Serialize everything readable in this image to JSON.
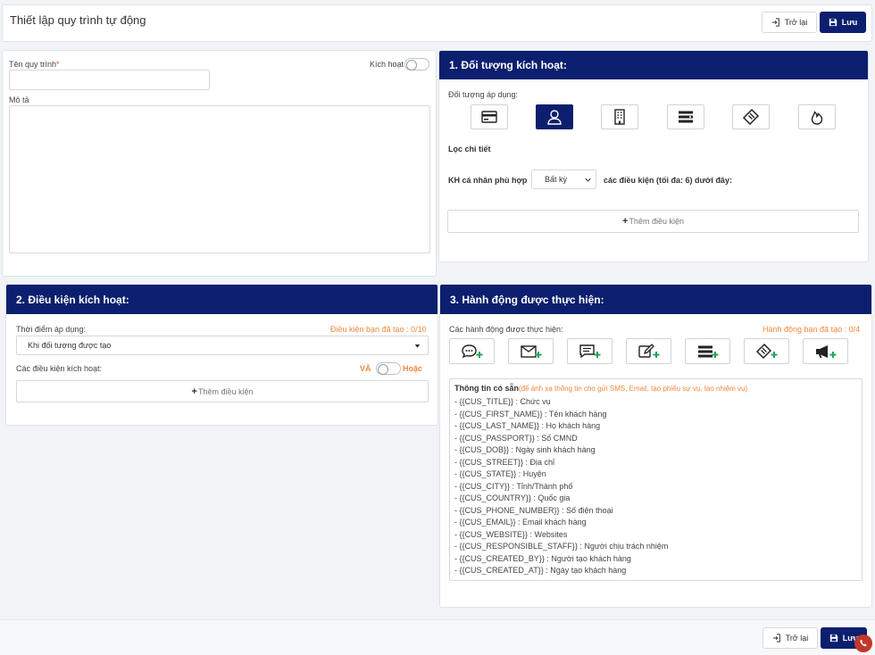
{
  "header": {
    "title": "Thiết lập quy trình tự động",
    "back_label": "Trở lại",
    "save_label": "Lưu"
  },
  "form": {
    "name_label": "Tên quy trình",
    "required_mark": "*",
    "active_label": "Kích hoạt",
    "description_label": "Mô tả"
  },
  "section1": {
    "title": "1. Đối tượng kích hoạt:",
    "applies_label": "Đối tượng áp dụng:",
    "target_icons": [
      "card-icon",
      "person-icon",
      "building-icon",
      "list-icon",
      "ticket-icon",
      "fire-icon"
    ],
    "filter_label": "Lọc chi tiết",
    "match_prefix": "KH cá nhân phù hợp",
    "match_select": "Bất kỳ",
    "match_suffix": "các điều kiện (tối đa: 6) dưới đây:",
    "add_condition": "Thêm điều kiện"
  },
  "section2": {
    "title": "2. Điều kiện kích hoạt:",
    "time_label": "Thời điểm áp dụng:",
    "counter": "Điều kiện bạn đã tạo : 0/10",
    "time_select": "Khi đối tượng được tạo",
    "conditions_label": "Các điều kiện kích hoạt:",
    "and_label": "VÀ",
    "or_label": "Hoặc",
    "add_condition": "Thêm điều kiện"
  },
  "section3": {
    "title": "3. Hành động được thực hiện:",
    "actions_label": "Các hành động được thực hiện:",
    "counter": "Hành động bạn đã tạo : 0/4",
    "action_icons": [
      "chat-icon",
      "email-icon",
      "message-icon",
      "edit-icon",
      "list-icon",
      "ticket-icon",
      "megaphone-icon"
    ],
    "info_title": "Thông tin có sẵn",
    "info_note": "(để ánh xạ thông tin cho gửi SMS, Email, tạo phiếu sự vụ, tạo nhiệm vụ)",
    "variables": [
      "- {{CUS_TITLE}} : Chức vụ",
      "- {{CUS_FIRST_NAME}} : Tên khách hàng",
      "- {{CUS_LAST_NAME}} : Họ khách hàng",
      "- {{CUS_PASSPORT}} : Số CMND",
      "- {{CUS_DOB}} : Ngày sinh khách hàng",
      "- {{CUS_STREET}} : Địa chỉ",
      "- {{CUS_STATE}} : Huyện",
      "- {{CUS_CITY}} : Tỉnh/Thành phố",
      "- {{CUS_COUNTRY}} : Quốc gia",
      "- {{CUS_PHONE_NUMBER}} : Số điện thoại",
      "- {{CUS_EMAIL}} : Email khách hàng",
      "- {{CUS_WEBSITE}} : Websites",
      "- {{CUS_RESPONSIBLE_STAFF}} : Người chịu trách nhiệm",
      "- {{CUS_CREATED_BY}} : Người tạo khách hàng",
      "- {{CUS_CREATED_AT}} : Ngày tạo khách hàng"
    ]
  },
  "footer": {
    "back_label": "Trở lại",
    "save_label": "Lưu"
  },
  "colors": {
    "primary": "#0c1f6e",
    "accent_orange": "#f0883e",
    "required": "#e24545",
    "fab": "#c0392b"
  }
}
